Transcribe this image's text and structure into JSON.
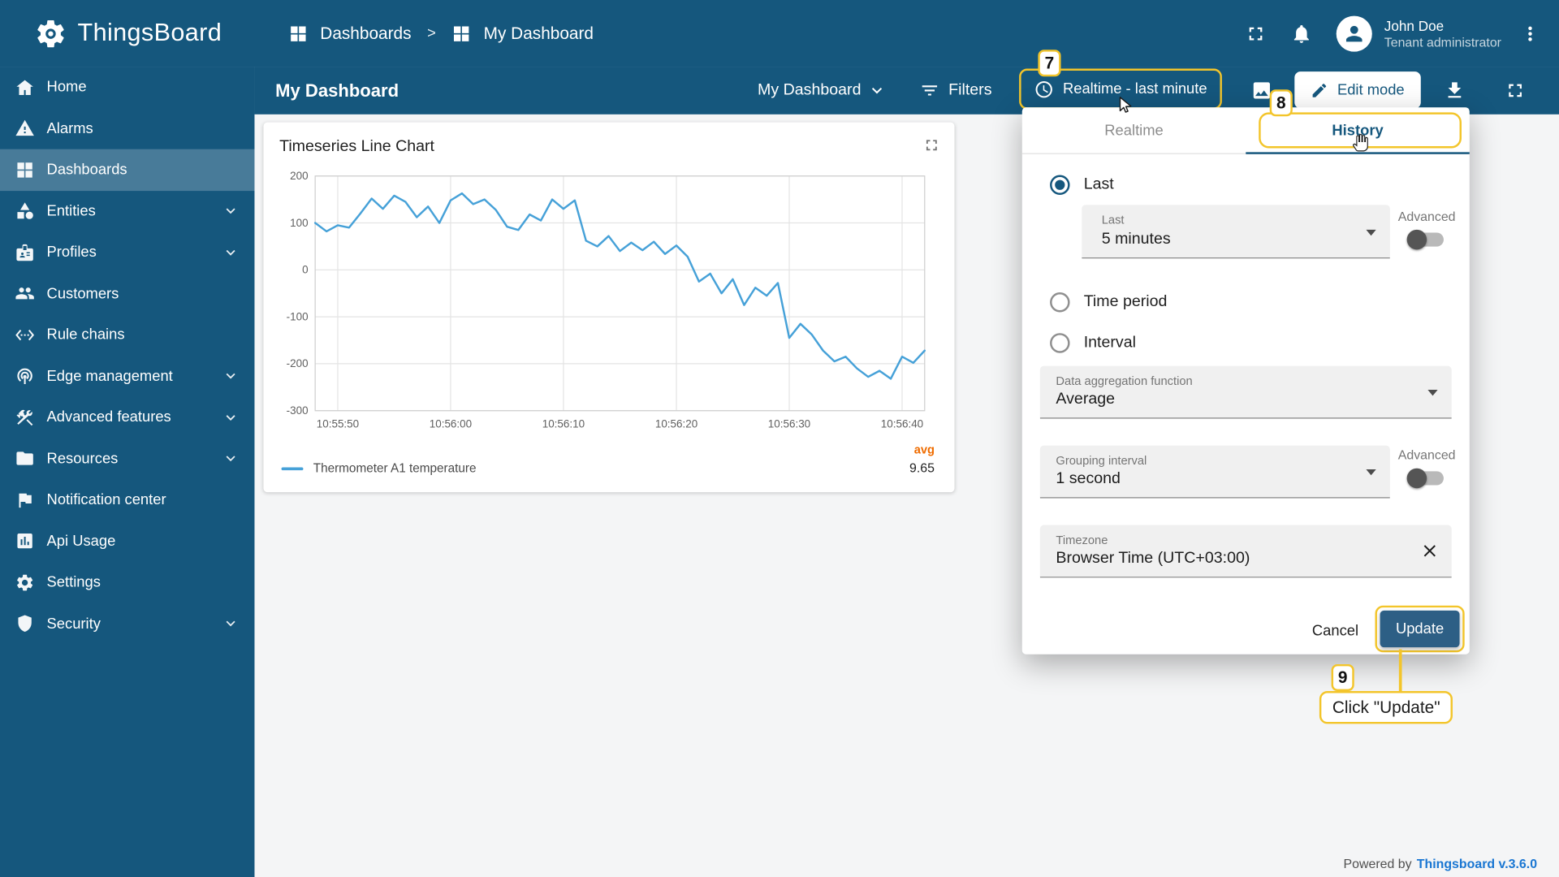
{
  "app": {
    "title": "ThingsBoard"
  },
  "colors": {
    "primary": "#15577d",
    "highlight": "#f3c52b",
    "series_line": "#46a1d8",
    "avg_text": "#ef6c00",
    "link": "#1976d2",
    "update_button": "#2d5f85"
  },
  "header": {
    "breadcrumb": {
      "root": "Dashboards",
      "separator": ">",
      "current": "My Dashboard"
    },
    "user": {
      "name": "John Doe",
      "role": "Tenant administrator"
    }
  },
  "sidebar": {
    "items": [
      {
        "id": "home",
        "label": "Home",
        "icon": "home-icon",
        "selected": false,
        "expandable": false
      },
      {
        "id": "alarms",
        "label": "Alarms",
        "icon": "alarms-icon",
        "selected": false,
        "expandable": false
      },
      {
        "id": "dashboards",
        "label": "Dashboards",
        "icon": "dashboards-icon",
        "selected": true,
        "expandable": false
      },
      {
        "id": "entities",
        "label": "Entities",
        "icon": "entities-icon",
        "selected": false,
        "expandable": true
      },
      {
        "id": "profiles",
        "label": "Profiles",
        "icon": "profiles-icon",
        "selected": false,
        "expandable": true
      },
      {
        "id": "customers",
        "label": "Customers",
        "icon": "customers-icon",
        "selected": false,
        "expandable": false
      },
      {
        "id": "rule-chains",
        "label": "Rule chains",
        "icon": "rule-chains-icon",
        "selected": false,
        "expandable": false
      },
      {
        "id": "edge-management",
        "label": "Edge management",
        "icon": "edge-icon",
        "selected": false,
        "expandable": true
      },
      {
        "id": "advanced-features",
        "label": "Advanced features",
        "icon": "tools-icon",
        "selected": false,
        "expandable": true
      },
      {
        "id": "resources",
        "label": "Resources",
        "icon": "folder-icon",
        "selected": false,
        "expandable": true
      },
      {
        "id": "notification-center",
        "label": "Notification center",
        "icon": "flag-icon",
        "selected": false,
        "expandable": false
      },
      {
        "id": "api-usage",
        "label": "Api Usage",
        "icon": "chart-icon",
        "selected": false,
        "expandable": false
      },
      {
        "id": "settings",
        "label": "Settings",
        "icon": "gear-icon",
        "selected": false,
        "expandable": false
      },
      {
        "id": "security",
        "label": "Security",
        "icon": "shield-icon",
        "selected": false,
        "expandable": true
      }
    ]
  },
  "toolbar": {
    "page_title": "My Dashboard",
    "dashboard_select": "My Dashboard",
    "filters_label": "Filters",
    "timewindow_label": "Realtime - last minute",
    "edit_mode_label": "Edit mode"
  },
  "widget": {
    "title": "Timeseries Line Chart",
    "legend": {
      "series_label": "Thermometer A1 temperature",
      "agg_label": "avg",
      "agg_value": "9.65"
    }
  },
  "chart_data": {
    "type": "line",
    "title": "Timeseries Line Chart",
    "grid": true,
    "legend_position": "bottom",
    "ylim": [
      -300,
      200
    ],
    "y_ticks": [
      200,
      100,
      0,
      -100,
      -200,
      -300
    ],
    "x_tick_labels": [
      "10:55:50",
      "10:56:00",
      "10:56:10",
      "10:56:20",
      "10:56:30",
      "10:56:40"
    ],
    "x_tick_indices": [
      2,
      12,
      22,
      32,
      42,
      52
    ],
    "x_count": 55,
    "avg": 9.65,
    "series": [
      {
        "name": "Thermometer A1 temperature",
        "color": "#46a1d8",
        "values": [
          100,
          82,
          95,
          90,
          120,
          152,
          130,
          158,
          145,
          112,
          135,
          100,
          148,
          163,
          140,
          150,
          128,
          92,
          85,
          118,
          105,
          150,
          130,
          148,
          62,
          50,
          72,
          40,
          58,
          42,
          60,
          34,
          52,
          28,
          -25,
          -8,
          -50,
          -20,
          -75,
          -38,
          -55,
          -28,
          -145,
          -115,
          -138,
          -172,
          -195,
          -185,
          -210,
          -228,
          -215,
          -232,
          -185,
          -198,
          -172
        ]
      }
    ]
  },
  "dialog": {
    "tabs": [
      {
        "label": "Realtime",
        "active": false
      },
      {
        "label": "History",
        "active": true
      }
    ],
    "options": [
      {
        "label": "Last",
        "selected": true
      },
      {
        "label": "Time period",
        "selected": false
      },
      {
        "label": "Interval",
        "selected": false
      }
    ],
    "fields": {
      "last": {
        "label": "Last",
        "value": "5 minutes"
      },
      "aggregation": {
        "label": "Data aggregation function",
        "value": "Average"
      },
      "grouping": {
        "label": "Grouping interval",
        "value": "1 second"
      },
      "timezone": {
        "label": "Timezone",
        "value": "Browser Time (UTC+03:00)"
      }
    },
    "advanced_label": "Advanced",
    "buttons": {
      "cancel": "Cancel",
      "update": "Update"
    }
  },
  "callouts": {
    "step7": "7",
    "step8": "8",
    "step9": "9",
    "click_update": "Click \"Update\""
  },
  "footer": {
    "powered_by": "Powered by",
    "version_link": "Thingsboard v.3.6.0"
  }
}
